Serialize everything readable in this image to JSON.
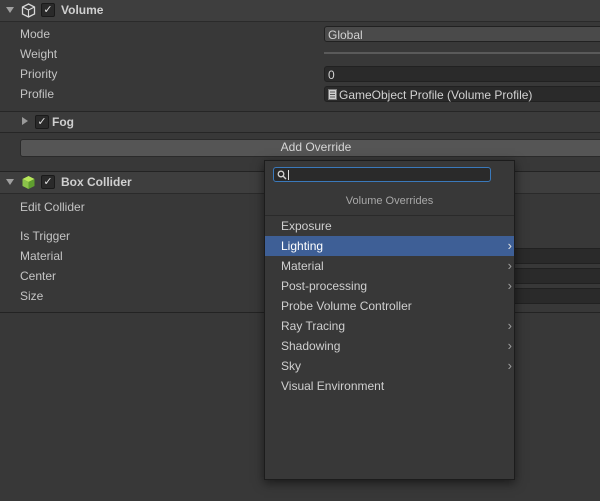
{
  "volume": {
    "title": "Volume",
    "mode_label": "Mode",
    "mode_value": "Global",
    "weight_label": "Weight",
    "priority_label": "Priority",
    "priority_value": "0",
    "profile_label": "Profile",
    "profile_value": "GameObject Profile (Volume Profile)",
    "fog_label": "Fog",
    "add_override_label": "Add Override"
  },
  "box_collider": {
    "title": "Box Collider",
    "edit_collider_label": "Edit Collider",
    "is_trigger_label": "Is Trigger",
    "material_label": "Material",
    "center_label": "Center",
    "size_label": "Size"
  },
  "dropdown": {
    "title": "Volume Overrides",
    "search_value": "",
    "items": [
      {
        "label": "Exposure",
        "submenu": false,
        "selected": false
      },
      {
        "label": "Lighting",
        "submenu": true,
        "selected": true
      },
      {
        "label": "Material",
        "submenu": true,
        "selected": false
      },
      {
        "label": "Post-processing",
        "submenu": true,
        "selected": false
      },
      {
        "label": "Probe Volume Controller",
        "submenu": false,
        "selected": false
      },
      {
        "label": "Ray Tracing",
        "submenu": true,
        "selected": false
      },
      {
        "label": "Shadowing",
        "submenu": true,
        "selected": false
      },
      {
        "label": "Sky",
        "submenu": true,
        "selected": false
      },
      {
        "label": "Visual Environment",
        "submenu": false,
        "selected": false
      }
    ]
  },
  "colors": {
    "background": "#383838",
    "selection": "#3e5f96",
    "focus_border": "#3a79bb"
  },
  "icons": {
    "volume_component": "cube-outline-icon",
    "box_collider_component": "green-cube-icon",
    "profile_asset": "volume-profile-icon",
    "search": "search-icon",
    "submenu": "chevron-right-icon"
  }
}
